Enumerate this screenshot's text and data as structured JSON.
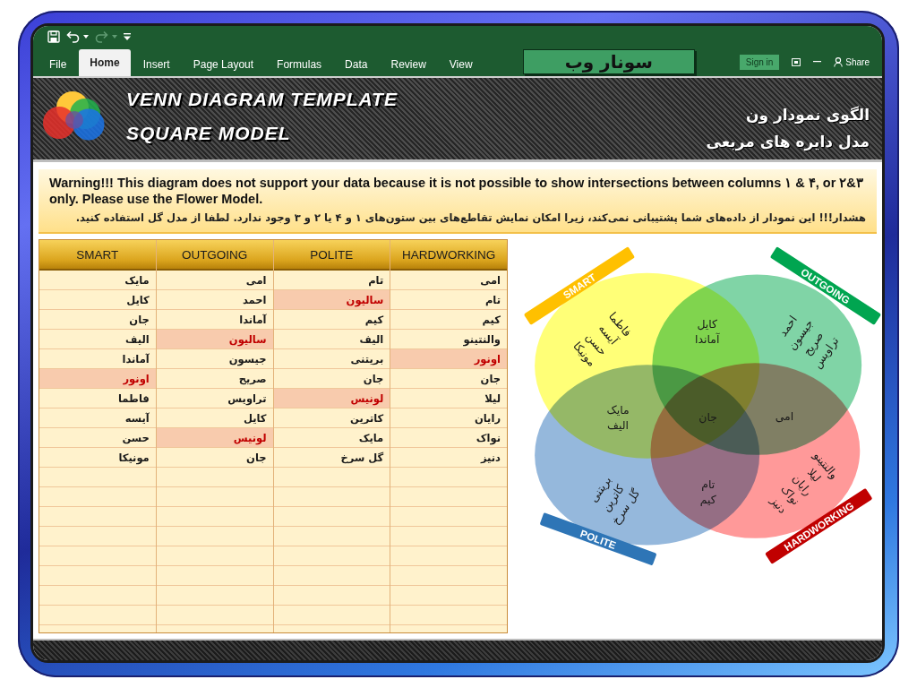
{
  "quick_access": [
    {
      "kind": "save",
      "disabled": false
    },
    {
      "kind": "undo",
      "disabled": false
    },
    {
      "kind": "redo",
      "disabled": true
    },
    {
      "kind": "customize",
      "disabled": false
    }
  ],
  "ribbon_tabs": [
    {
      "label": "View",
      "selected": false
    },
    {
      "label": "Review",
      "selected": false
    },
    {
      "label": "Data",
      "selected": false
    },
    {
      "label": "Formulas",
      "selected": false
    },
    {
      "label": "Page Layout",
      "selected": false
    },
    {
      "label": "Insert",
      "selected": false
    },
    {
      "label": "Home",
      "selected": true
    },
    {
      "label": "File",
      "selected": false
    }
  ],
  "brand": "سونار وب",
  "account": {
    "sign_in": "Sign in",
    "share": "Share"
  },
  "banner": {
    "title_en": [
      "VENN DIAGRAM TEMPLATE",
      "SQUARE MODEL"
    ],
    "title_fa": [
      "الگوی نمودار ون",
      "مدل دایره های مربعی"
    ]
  },
  "warning": {
    "en": "Warning!!! This diagram does not support your data because it is not possible to show intersections between columns ۱ & ۴, or ۲&۳ only. Please use the Flower Model.",
    "fa": "هشدار!!! این نمودار از داده‌های شما پشتیبانی نمی‌کند، زیرا امکان نمایش تقاطع‌های بین ستون‌های ۱ و ۴ یا ۲ و ۳ وجود ندارد. لطفا از مدل گل استفاده کنید."
  },
  "table": {
    "columns": [
      {
        "title": "HARDWORKING",
        "cells": [
          {
            "text": "امی",
            "highlighted": false
          },
          {
            "text": "تام",
            "highlighted": false
          },
          {
            "text": "کیم",
            "highlighted": false
          },
          {
            "text": "والنتینو",
            "highlighted": false
          },
          {
            "text": "اونور",
            "highlighted": true
          },
          {
            "text": "جان",
            "highlighted": false
          },
          {
            "text": "لیلا",
            "highlighted": false
          },
          {
            "text": "رایان",
            "highlighted": false
          },
          {
            "text": "نواک",
            "highlighted": false
          },
          {
            "text": "دنیز",
            "highlighted": false
          }
        ]
      },
      {
        "title": "POLITE",
        "cells": [
          {
            "text": "تام",
            "highlighted": false
          },
          {
            "text": "سالیون",
            "highlighted": true
          },
          {
            "text": "کیم",
            "highlighted": false
          },
          {
            "text": "الیف",
            "highlighted": false
          },
          {
            "text": "بریتنی",
            "highlighted": false
          },
          {
            "text": "جان",
            "highlighted": false
          },
          {
            "text": "لونیس",
            "highlighted": true
          },
          {
            "text": "کاترین",
            "highlighted": false
          },
          {
            "text": "مایک",
            "highlighted": false
          },
          {
            "text": "گل سرخ",
            "highlighted": false
          }
        ]
      },
      {
        "title": "OUTGOING",
        "cells": [
          {
            "text": "امی",
            "highlighted": false
          },
          {
            "text": "احمد",
            "highlighted": false
          },
          {
            "text": "آماندا",
            "highlighted": false
          },
          {
            "text": "سالیون",
            "highlighted": true
          },
          {
            "text": "جیسون",
            "highlighted": false
          },
          {
            "text": "صریح",
            "highlighted": false
          },
          {
            "text": "تراویس",
            "highlighted": false
          },
          {
            "text": "کایل",
            "highlighted": false
          },
          {
            "text": "لونیس",
            "highlighted": true
          },
          {
            "text": "جان",
            "highlighted": false
          }
        ]
      },
      {
        "title": "SMART",
        "cells": [
          {
            "text": "مایک",
            "highlighted": false
          },
          {
            "text": "کایل",
            "highlighted": false
          },
          {
            "text": "جان",
            "highlighted": false
          },
          {
            "text": "الیف",
            "highlighted": false
          },
          {
            "text": "آماندا",
            "highlighted": false
          },
          {
            "text": "اونور",
            "highlighted": true
          },
          {
            "text": "فاطما",
            "highlighted": false
          },
          {
            "text": "آیسه",
            "highlighted": false
          },
          {
            "text": "حسن",
            "highlighted": false
          },
          {
            "text": "مونیکا",
            "highlighted": false
          }
        ]
      }
    ]
  },
  "venn": {
    "circles": [
      {
        "color": "#80d4a6"
      },
      {
        "color": "#ffff77"
      },
      {
        "color": "#ff9999"
      },
      {
        "color": "#95b8dc"
      }
    ],
    "tags": [
      {
        "label": "OUTGOING",
        "color": "#00a550"
      },
      {
        "label": "SMART",
        "color": "#ffc000"
      },
      {
        "label": "HARDWORKING",
        "color": "#c00000"
      },
      {
        "label": "POLITE",
        "color": "#2e75b6"
      }
    ],
    "regions": [
      {
        "names": [
          "احمد",
          "جیسون",
          "صریح",
          "تراویس"
        ]
      },
      {
        "names": [
          "کایل",
          "آماندا"
        ]
      },
      {
        "names": [
          "فاطما",
          "آیسه",
          "حسن",
          "مونیکا"
        ]
      },
      {
        "names": [
          "امی"
        ]
      },
      {
        "names": [
          "جان"
        ]
      },
      {
        "names": [
          "مایک",
          "الیف"
        ]
      },
      {
        "names": [
          "والنتینو",
          "لیلا",
          "رایان",
          "نواک",
          "دنیز"
        ]
      },
      {
        "names": [
          "تام",
          "کیم"
        ]
      },
      {
        "names": [
          "بریتنی",
          "کاترین",
          "گل سرخ"
        ]
      }
    ]
  }
}
